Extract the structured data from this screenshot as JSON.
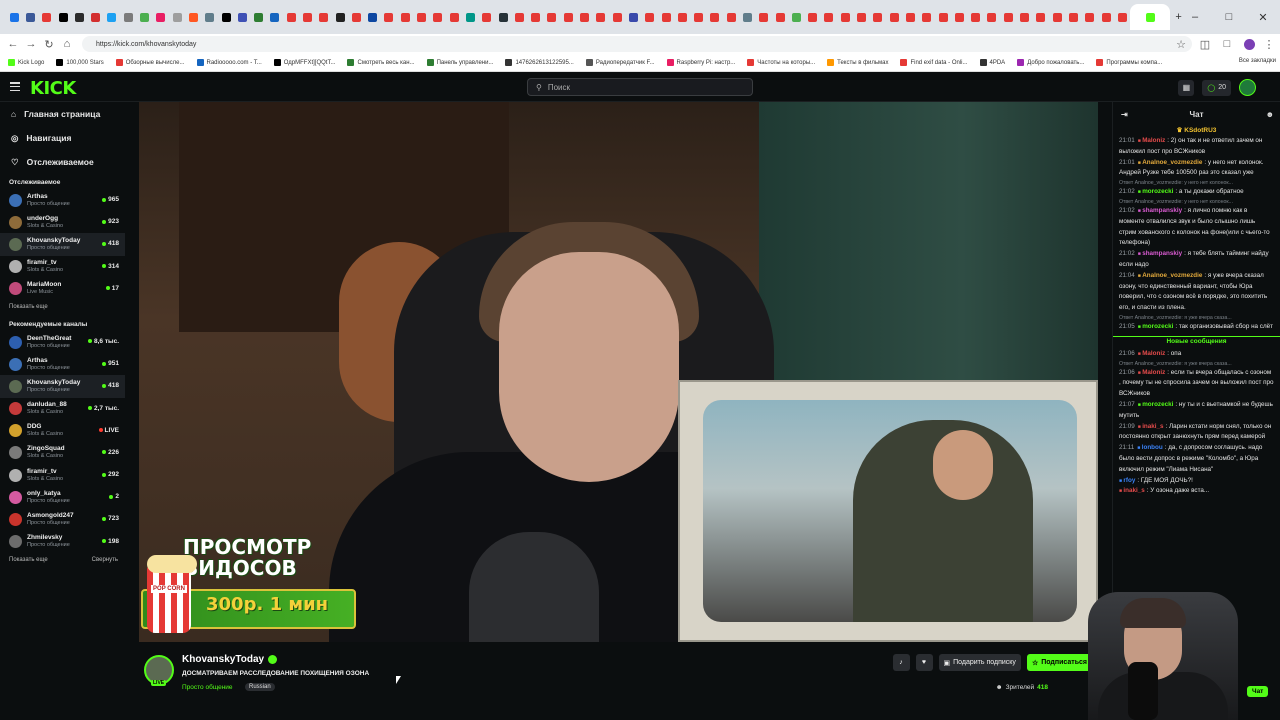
{
  "browser": {
    "url": "https://kick.com/khovanskytoday",
    "bookmarks": [
      "Kick Logo",
      "100,000 Stars",
      "Обзорные вычисле...",
      "Radiooooo.com - T...",
      "ОдрMFFXt][QQtT...",
      "Смотреть весь кан...",
      "Панель управлени...",
      "1476262613122595...",
      "Радиопередатчик F...",
      "Raspberry Pi: настр...",
      "Частоты на которы...",
      "Тексты в фильмах",
      "Find exif data - Onli...",
      "4PDA",
      "Добро пожаловать...",
      "Программы компа..."
    ],
    "all_bookmarks": "Все закладки"
  },
  "topbar": {
    "logo": "KICK",
    "search_placeholder": "Поиск",
    "points": "20"
  },
  "sidebar": {
    "nav": [
      {
        "icon": "home-icon",
        "label": "Главная страница"
      },
      {
        "icon": "compass-icon",
        "label": "Навигация"
      },
      {
        "icon": "heart-icon",
        "label": "Отслеживаемое"
      }
    ],
    "following_title": "Отслеживаемое",
    "following": [
      {
        "name": "Arthas",
        "category": "Просто общение",
        "viewers": "965",
        "color": "#3b6fb5"
      },
      {
        "name": "underOgg",
        "category": "Slots & Casino",
        "viewers": "923",
        "color": "#8e6b3a"
      },
      {
        "name": "KhovanskyToday",
        "category": "Просто общение",
        "viewers": "418",
        "color": "#5b6a52"
      },
      {
        "name": "firamir_tv",
        "category": "Slots & Casino",
        "viewers": "314",
        "color": "#b0b0b0"
      },
      {
        "name": "MariaMoon",
        "category": "Live Music",
        "viewers": "17",
        "color": "#c04a7a"
      }
    ],
    "show_more": "Показать еще",
    "recommended_title": "Рекомендуемые каналы",
    "recommended": [
      {
        "name": "DeenTheGreat",
        "category": "Просто общение",
        "viewers": "8,6 тыс.",
        "color": "#2d5fb0"
      },
      {
        "name": "Arthas",
        "category": "Просто общение",
        "viewers": "951",
        "color": "#3b6fb5"
      },
      {
        "name": "KhovanskyToday",
        "category": "Просто общение",
        "viewers": "418",
        "color": "#5b6a52"
      },
      {
        "name": "danludan_88",
        "category": "Slots & Casino",
        "viewers": "2,7 тыс.",
        "color": "#c43a3a"
      },
      {
        "name": "DDG",
        "category": "Slots & Casino",
        "viewers": "LIVE",
        "color": "#d2a12c"
      },
      {
        "name": "ZingoSquad",
        "category": "Slots & Casino",
        "viewers": "226",
        "color": "#7a7a7a"
      },
      {
        "name": "firamir_tv",
        "category": "Slots & Casino",
        "viewers": "292",
        "color": "#b0b0b0"
      },
      {
        "name": "only_katya",
        "category": "Просто общение",
        "viewers": "2",
        "color": "#d45aa0"
      },
      {
        "name": "Asmongold247",
        "category": "Просто общение",
        "viewers": "723",
        "color": "#c9342c"
      },
      {
        "name": "Zhmilevsky",
        "category": "Просто общение",
        "viewers": "198",
        "color": "#6c6c6c"
      }
    ],
    "show_more2": "Показать еще",
    "collapse": "Свернуть"
  },
  "video": {
    "promo_title_1": "ПРОСМОТР",
    "promo_title_2": "ВИДОСОВ",
    "promo_price": "300р. 1 мин",
    "popcorn_label": "POP CORN"
  },
  "stream": {
    "channel": "KhovanskyToday",
    "title": "ДОСМАТРИВАЕМ РАССЛЕДОВАНИЕ ПОХИЩЕНИЯ ОЗОНА",
    "category": "Просто общение",
    "tag": "Russian",
    "live": "LIVE",
    "gift_sub": "Подарить подписку",
    "subscribe": "Подписаться",
    "viewers_label": "Зрителей",
    "viewers": "418"
  },
  "chat": {
    "title": "Чат",
    "pinned": "KSdotRU3",
    "messages": [
      {
        "time": "21:01",
        "user": "Maloniz",
        "color": "#e44b4b",
        "text": "2) он так и не ответил зачем он выложил пост про ВСЖников"
      },
      {
        "time": "21:01",
        "user": "Analnoe_vozmezdie",
        "color": "#e2a93c",
        "text": "у него нет колонок. Андрей Рузке тебе 100500 раз это сказал уже"
      },
      {
        "reply": "Ответ Analnoe_vozmezdie: у него нет колонок..."
      },
      {
        "time": "21:02",
        "user": "morozecki",
        "color": "#53fc18",
        "text": "а ты докажи обратное"
      },
      {
        "reply": "Ответ Analnoe_vozmezdie: у него нет колонок..."
      },
      {
        "time": "21:02",
        "user": "shampanskiy",
        "color": "#d95bd1",
        "text": "я лично помню как в моменте отвалился звук и было слышно лишь стрим хованского с колонок на фоне(или с чьего-то телефона)"
      },
      {
        "time": "21:02",
        "user": "shampanskiy",
        "color": "#d95bd1",
        "text": "я тебе блять тайминг найду если надо"
      },
      {
        "time": "21:04",
        "user": "Analnoe_vozmezdie",
        "color": "#e2a93c",
        "text": "я уже вчера сказал озону, что единственный вариант, чтобы Юра поверил, что с озоном всё в порядке, это похитить его, и спасти из плена."
      },
      {
        "reply": "Ответ Analnoe_vozmezdie: я уже вчера сказа..."
      },
      {
        "time": "21:05",
        "user": "morozecki",
        "color": "#53fc18",
        "text": "так организовывай сбор на слёт"
      }
    ],
    "new_messages": "Новые сообщения",
    "messages2": [
      {
        "time": "21:06",
        "user": "Maloniz",
        "color": "#e44b4b",
        "text": "опа"
      },
      {
        "reply": "Ответ Analnoe_vozmezdie: я уже вчера сказа..."
      },
      {
        "time": "21:06",
        "user": "Maloniz",
        "color": "#e44b4b",
        "text": "если ты вчера общалась с озоном , почему ты не спросила зачем он выложил пост про ВСЖников"
      },
      {
        "time": "21:07",
        "user": "morozecki",
        "color": "#53fc18",
        "text": "ну ты и с вьетнамкой не будешь мутить"
      },
      {
        "time": "21:09",
        "user": "inaki_s",
        "color": "#e44b4b",
        "text": "Ларин кстати норм снял, только он постоянно открыт занюхнуть прям перед камерой"
      },
      {
        "time": "21:11",
        "user": "lonbou",
        "color": "#3b82f6",
        "text": "да, с допросом соглашусь. надо было вести допрос в режиме \"Коломбо\", а Юра включил режим \"Лиама Нисана\""
      },
      {
        "time": "",
        "user": "rfoy",
        "color": "#3b82f6",
        "text": "ГДЕ МОЯ ДОЧЬ?!"
      },
      {
        "time": "",
        "user": "inaki_s",
        "color": "#e44b4b",
        "text": "У озона даже вста..."
      }
    ],
    "chat_button": "Чат"
  }
}
